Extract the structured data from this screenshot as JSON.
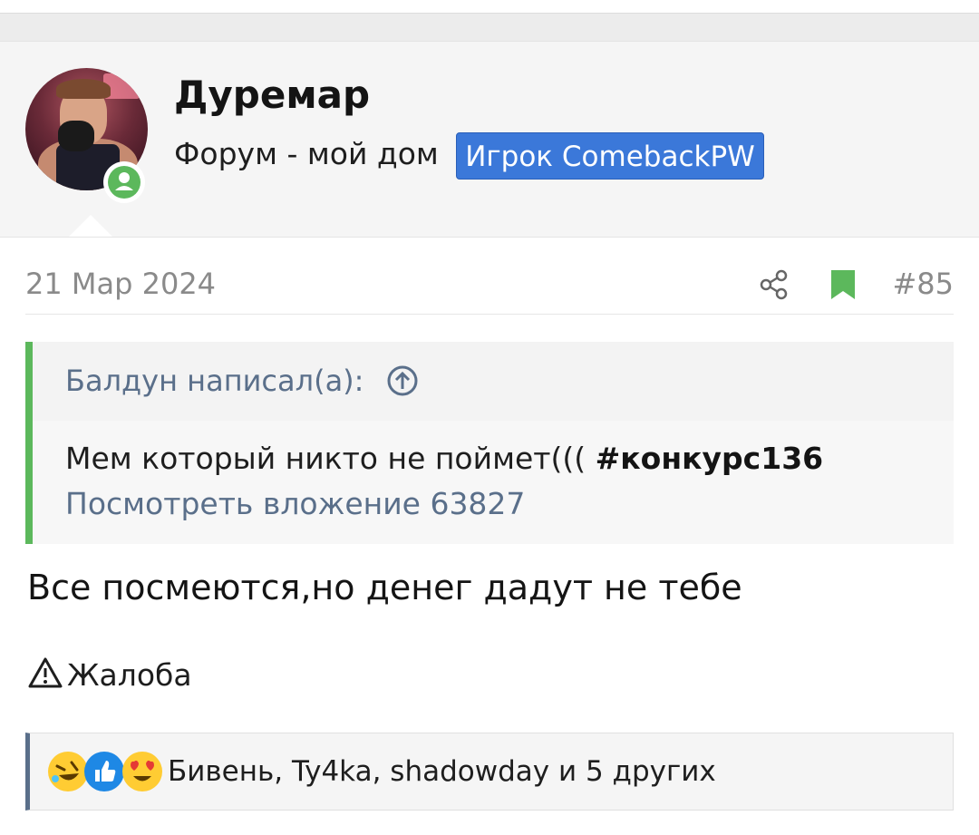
{
  "user": {
    "name": "Дуремар",
    "title": "Форум - мой дом",
    "banner": "Игрок ComebackPW"
  },
  "post": {
    "date": "21 Мар 2024",
    "number": "#85",
    "body": "Все посмеются,но денег дадут не тебе"
  },
  "quote": {
    "author": "Балдун написал(а):",
    "text": "Мем который никто не поймет(((",
    "hashtag": "#конкурс136",
    "attachment": "Посмотреть вложение 63827"
  },
  "actions": {
    "report": "Жалоба"
  },
  "reactions": {
    "emojis": [
      "rofl-emoji",
      "like-emoji",
      "heart-eyes-emoji"
    ],
    "users": "Бивень, Ty4ka, shadowday и 5 других"
  },
  "colors": {
    "banner": "#3b78d9",
    "online": "#5cb85c",
    "quote_border": "#5cb85c",
    "link": "#5a6f8a"
  }
}
